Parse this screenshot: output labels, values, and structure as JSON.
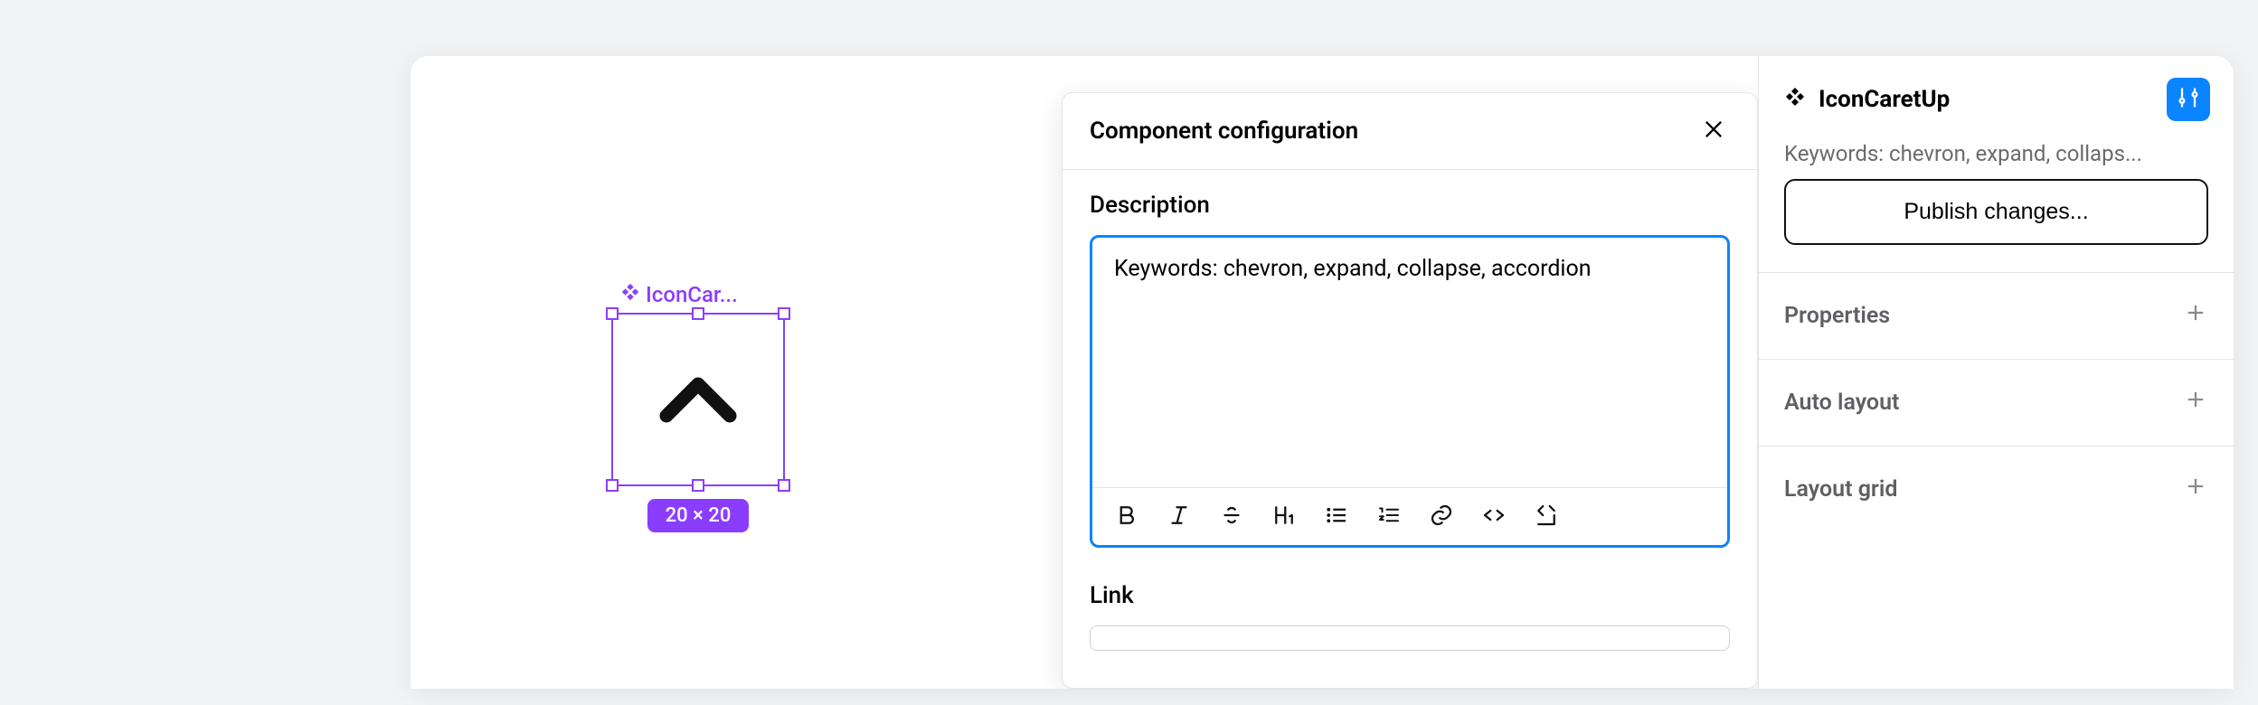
{
  "canvas": {
    "component_label": "IconCar...",
    "dimensions": "20 × 20"
  },
  "config_panel": {
    "title": "Component configuration",
    "description_label": "Description",
    "description_value": "Keywords: chevron, expand, collapse, accordion",
    "link_label": "Link"
  },
  "inspector": {
    "component_name": "IconCaretUp",
    "keywords_preview": "Keywords: chevron, expand, collaps...",
    "publish_label": "Publish changes...",
    "sections": {
      "properties": "Properties",
      "auto_layout": "Auto layout",
      "layout_grid": "Layout grid"
    }
  }
}
